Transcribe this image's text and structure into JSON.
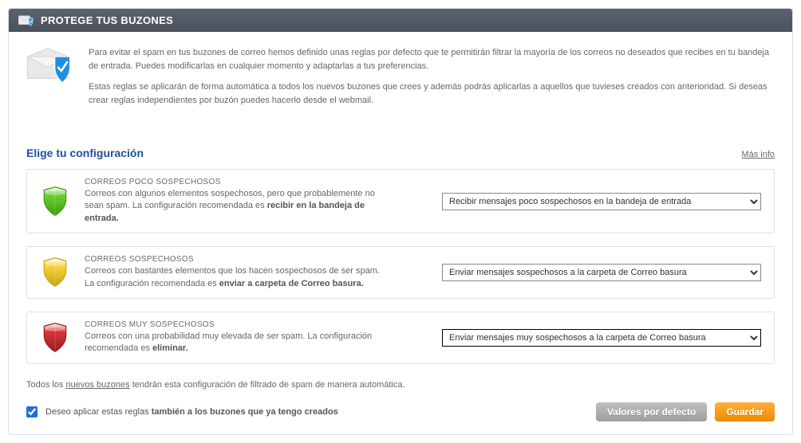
{
  "header": {
    "title": "PROTEGE TUS BUZONES"
  },
  "intro": {
    "p1": "Para evitar el spam en tus buzones de correo hemos definido unas reglas por defecto que te permitirán filtrar la mayoría de los correos no deseados que recibes en tu bandeja de entrada. Puedes modificarlas en cualquier momento y adaptarlas a tus preferencias.",
    "p2": "Estas reglas se aplicarán de forma automática a todos los nuevos buzones que crees y además podrás aplicarlas a aquellos que tuvieses creados con anterioridad. Si deseas crear reglas independientes por buzón puedes hacerlo desde el webmail."
  },
  "section": {
    "title": "Elige tu configuración",
    "more_info": "Más info"
  },
  "rules": [
    {
      "shield_color": "#6ccf2f",
      "shield_stroke": "#3a9f12",
      "title": "CORREOS POCO SOSPECHOSOS",
      "desc_pre": "Correos con algunos elementos sospechosos, pero que probablemente no sean spam. La configuración recomendada es ",
      "desc_bold": "recibir en la bandeja de entrada.",
      "select_value": "Recibir mensajes poco sospechosos en la bandeja de entrada",
      "highlighted": false
    },
    {
      "shield_color": "#f5d23c",
      "shield_stroke": "#caa40d",
      "title": "CORREOS SOSPECHOSOS",
      "desc_pre": "Correos con bastantes elementos que los hacen sospechosos de ser spam. La configuración recomendada es ",
      "desc_bold": "enviar a carpeta de Correo basura.",
      "select_value": "Enviar mensajes sospechosos a la carpeta de Correo basura",
      "highlighted": false
    },
    {
      "shield_color": "#d8343a",
      "shield_stroke": "#9c1c20",
      "title": "CORREOS MUY SOSPECHOSOS",
      "desc_pre": "Correos con una probabilidad muy elevada de ser spam. La configuración recomendada es ",
      "desc_bold": "eliminar.",
      "select_value": "Enviar mensajes muy sospechosos a la carpeta de Correo basura",
      "highlighted": true
    }
  ],
  "footer": {
    "note_pre": "Todos los ",
    "note_underline": "nuevos buzones",
    "note_post": " tendrán esta configuración de filtrado de spam de manera automática.",
    "apply_pre": "Deseo aplicar estas reglas ",
    "apply_bold": "también a los buzones que ya tengo creados",
    "apply_checked": true,
    "defaults_label": "Valores por defecto",
    "save_label": "Guardar"
  }
}
